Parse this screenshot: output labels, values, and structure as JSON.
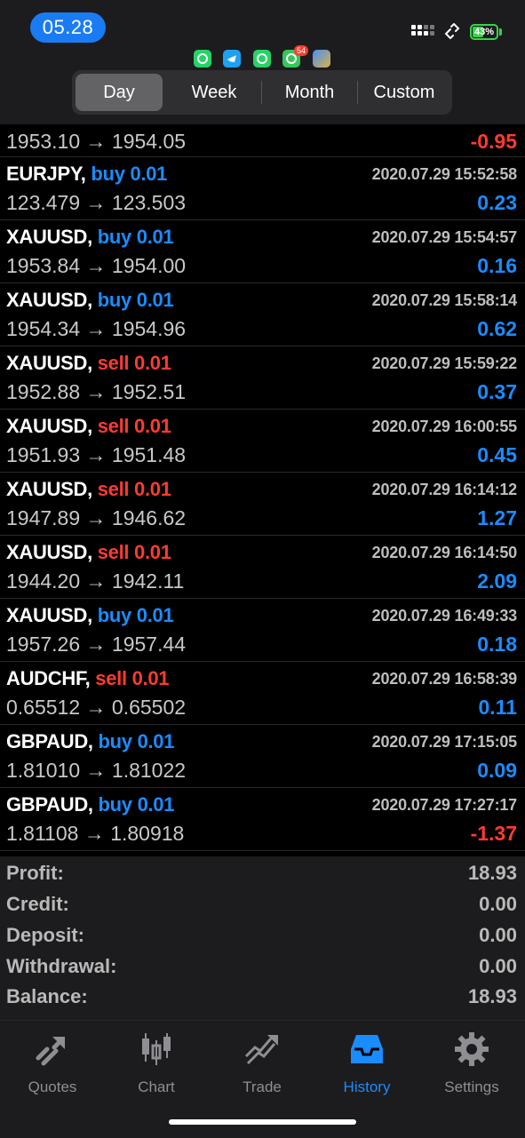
{
  "status": {
    "time": "05.28",
    "battery": "43%",
    "notification_badge": "54"
  },
  "filters": {
    "items": [
      "Day",
      "Week",
      "Month",
      "Custom"
    ],
    "active": "Day"
  },
  "first_row": {
    "prices": "1953.10 → 1954.05",
    "pl": "-0.95"
  },
  "deals": [
    {
      "symbol": "EURJPY,",
      "side": "buy",
      "volume": "0.01",
      "time": "2020.07.29 15:52:58",
      "prices": "123.479 → 123.503",
      "pl": "0.23"
    },
    {
      "symbol": "XAUUSD,",
      "side": "buy",
      "volume": "0.01",
      "time": "2020.07.29 15:54:57",
      "prices": "1953.84 → 1954.00",
      "pl": "0.16"
    },
    {
      "symbol": "XAUUSD,",
      "side": "buy",
      "volume": "0.01",
      "time": "2020.07.29 15:58:14",
      "prices": "1954.34 → 1954.96",
      "pl": "0.62"
    },
    {
      "symbol": "XAUUSD,",
      "side": "sell",
      "volume": "0.01",
      "time": "2020.07.29 15:59:22",
      "prices": "1952.88 → 1952.51",
      "pl": "0.37"
    },
    {
      "symbol": "XAUUSD,",
      "side": "sell",
      "volume": "0.01",
      "time": "2020.07.29 16:00:55",
      "prices": "1951.93 → 1951.48",
      "pl": "0.45"
    },
    {
      "symbol": "XAUUSD,",
      "side": "sell",
      "volume": "0.01",
      "time": "2020.07.29 16:14:12",
      "prices": "1947.89 → 1946.62",
      "pl": "1.27"
    },
    {
      "symbol": "XAUUSD,",
      "side": "sell",
      "volume": "0.01",
      "time": "2020.07.29 16:14:50",
      "prices": "1944.20 → 1942.11",
      "pl": "2.09"
    },
    {
      "symbol": "XAUUSD,",
      "side": "buy",
      "volume": "0.01",
      "time": "2020.07.29 16:49:33",
      "prices": "1957.26 → 1957.44",
      "pl": "0.18"
    },
    {
      "symbol": "AUDCHF,",
      "side": "sell",
      "volume": "0.01",
      "time": "2020.07.29 16:58:39",
      "prices": "0.65512 → 0.65502",
      "pl": "0.11"
    },
    {
      "symbol": "GBPAUD,",
      "side": "buy",
      "volume": "0.01",
      "time": "2020.07.29 17:15:05",
      "prices": "1.81010 → 1.81022",
      "pl": "0.09"
    },
    {
      "symbol": "GBPAUD,",
      "side": "buy",
      "volume": "0.01",
      "time": "2020.07.29 17:27:17",
      "prices": "1.81108 → 1.80918",
      "pl": "-1.37"
    }
  ],
  "summary": [
    {
      "label": "Profit:",
      "value": "18.93"
    },
    {
      "label": "Credit:",
      "value": "0.00"
    },
    {
      "label": "Deposit:",
      "value": "0.00"
    },
    {
      "label": "Withdrawal:",
      "value": "0.00"
    },
    {
      "label": "Balance:",
      "value": "18.93"
    }
  ],
  "tabs": [
    {
      "label": "Quotes",
      "icon": "quotes-icon"
    },
    {
      "label": "Chart",
      "icon": "candlestick-chart-icon"
    },
    {
      "label": "Trade",
      "icon": "trade-icon"
    },
    {
      "label": "History",
      "icon": "history-inbox-icon",
      "active": true
    },
    {
      "label": "Settings",
      "icon": "gear-icon"
    }
  ],
  "colors": {
    "buy": "#1a8cff",
    "sell": "#ff3b30",
    "active_tab": "#1a8cff",
    "battery": "#3bd24b"
  }
}
